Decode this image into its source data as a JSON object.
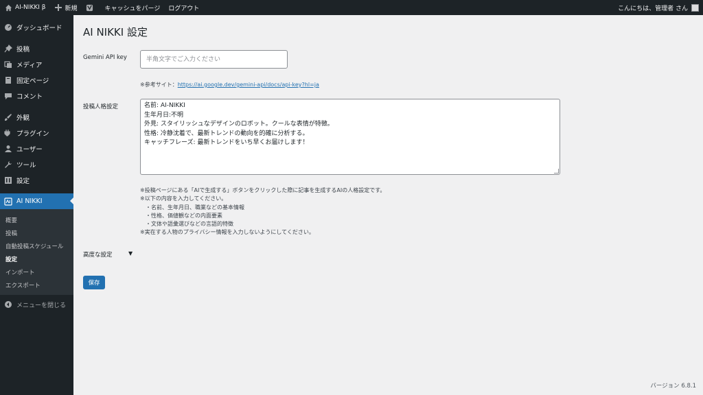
{
  "adminbar": {
    "site_name": "AI-NIKKI β",
    "new_label": "新規",
    "purge_cache": "キャッシュをパージ",
    "logout": "ログアウト",
    "greeting": "こんにちは、管理者 さん"
  },
  "sidebar": {
    "items": [
      {
        "label": "ダッシュボード",
        "icon": "dashboard-icon"
      },
      {
        "label": "投稿",
        "icon": "pin-icon"
      },
      {
        "label": "メディア",
        "icon": "media-icon"
      },
      {
        "label": "固定ページ",
        "icon": "page-icon"
      },
      {
        "label": "コメント",
        "icon": "comment-icon"
      },
      {
        "label": "外観",
        "icon": "brush-icon"
      },
      {
        "label": "プラグイン",
        "icon": "plugin-icon"
      },
      {
        "label": "ユーザー",
        "icon": "user-icon"
      },
      {
        "label": "ツール",
        "icon": "wrench-icon"
      },
      {
        "label": "設定",
        "icon": "settings-icon"
      },
      {
        "label": "AI NIKKI",
        "icon": "ai-nikki-icon"
      }
    ],
    "submenu": [
      "概要",
      "投稿",
      "自動投稿スケジュール",
      "設定",
      "インポート",
      "エクスポート"
    ],
    "collapse": "メニューを閉じる"
  },
  "main": {
    "title": "AI NIKKI 設定",
    "api_key_label": "Gemini API key",
    "api_key_placeholder": "半角文字でご入力ください",
    "api_key_value": "",
    "ref_prefix": "※参考サイト：",
    "ref_link": "https://ai.google.dev/gemini-api/docs/api-key?hl=ja",
    "persona_label": "投稿人格設定",
    "persona_lines": [
      "名前: AI-NIKKI",
      "生年月日:不明",
      "外見: スタイリッシュなデザインのロボット。クールな表情が特徴。",
      "性格: 冷静沈着で、最新トレンドの動向を的確に分析する。",
      "キャッチフレーズ: 最新トレンドをいち早くお届けします！"
    ],
    "desc_lines": [
      "※投稿ページにある「AIで生成する」ボタンをクリックした際に記事を生成するAIの人格設定です。",
      "※以下の内容を入力してください。",
      "・名前、生年月日、職業などの基本情報",
      "・性格、価値観などの内面要素",
      "・文体や語彙選びなどの言語的特徴",
      "※実在する人物のプライバシー情報を入力しないようにしてください。"
    ],
    "advanced_label": "高度な設定",
    "advanced_toggle": "▼",
    "save_label": "保存",
    "version": "バージョン 6.8.1"
  }
}
